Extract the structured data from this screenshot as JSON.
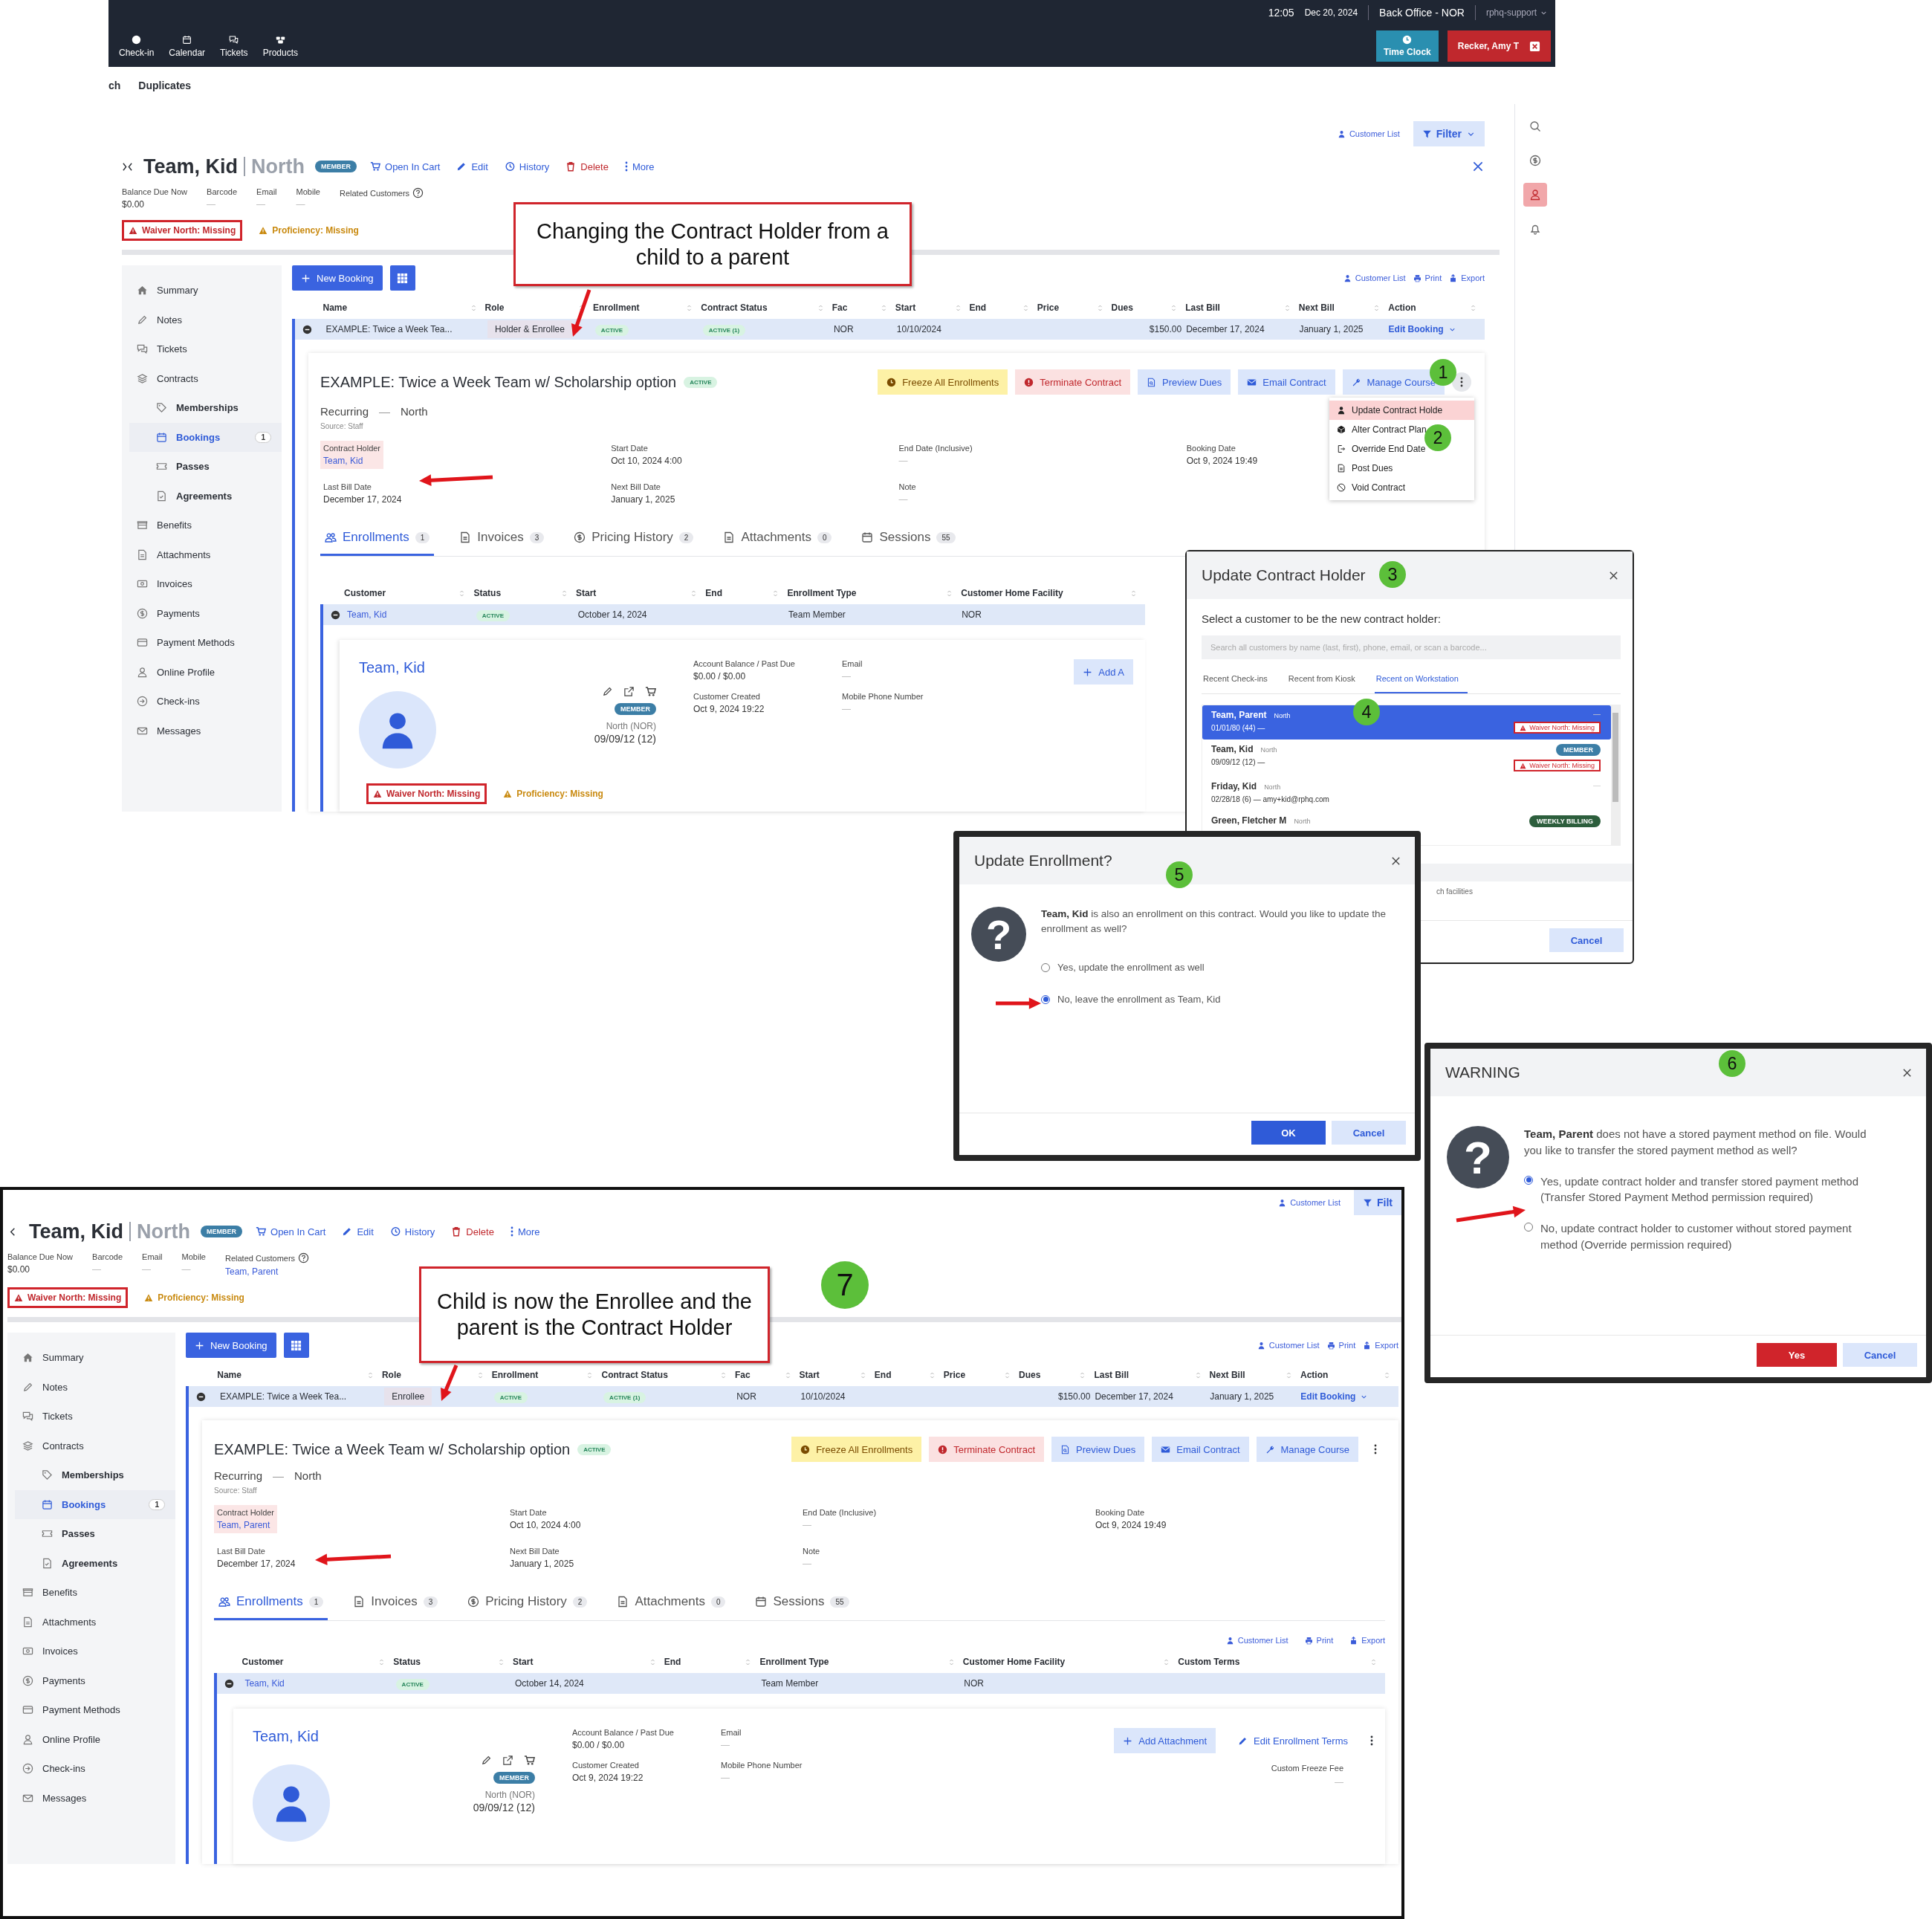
{
  "top_bar": {
    "time": "12:05",
    "date": "Dec 20, 2024",
    "location": "Back Office - NOR",
    "user_menu": "rphq-support",
    "nav": [
      {
        "label": "Check-in",
        "kind": "checkin"
      },
      {
        "label": "Calendar",
        "kind": "calendar"
      },
      {
        "label": "Tickets",
        "kind": "tickets"
      },
      {
        "label": "Products",
        "kind": "products"
      }
    ],
    "time_clock": "Time Clock",
    "staff": "Recker, Amy T"
  },
  "subnav": [
    {
      "label": "ch"
    },
    {
      "label": "Duplicates"
    }
  ],
  "rail": [
    {
      "kind": "search",
      "selected": false
    },
    {
      "kind": "dollar",
      "selected": false
    },
    {
      "kind": "profile",
      "selected": true
    },
    {
      "kind": "bell",
      "selected": false
    }
  ],
  "panels": [
    {
      "tools": [
        {
          "label": "Customer List",
          "kind": "link"
        },
        {
          "label": "Filter",
          "kind": "filter"
        }
      ],
      "name": "Team, Kid",
      "facility": "North",
      "badge": "MEMBER",
      "actions": [
        {
          "label": "Open In Cart",
          "kind": "cart"
        },
        {
          "label": "Edit",
          "kind": "edit"
        },
        {
          "label": "History",
          "kind": "history"
        },
        {
          "label": "Delete",
          "kind": "delete"
        },
        {
          "label": "More",
          "kind": "more"
        }
      ],
      "info": [
        {
          "label": "Balance Due Now",
          "value": "$0.00"
        },
        {
          "label": "Barcode",
          "value": "—"
        },
        {
          "label": "Email",
          "value": "—"
        },
        {
          "label": "Mobile",
          "value": "—"
        },
        {
          "label": "Related Customers",
          "help": true
        }
      ],
      "alerts": [
        {
          "label": "Waiver North: Missing",
          "kind": "error"
        },
        {
          "label": "Proficiency: Missing",
          "kind": "warning"
        }
      ],
      "sidebar": [
        {
          "label": "Summary",
          "kind": "home",
          "selected": false
        },
        {
          "label": "Notes",
          "kind": "notes",
          "selected": false
        },
        {
          "label": "Tickets",
          "kind": "tickets",
          "selected": false
        },
        {
          "label": "Contracts",
          "kind": "contracts",
          "selected": false,
          "children": [
            {
              "label": "Memberships",
              "kind": "tag",
              "selected": false
            },
            {
              "label": "Bookings",
              "kind": "calendar",
              "selected": true,
              "count": "1"
            },
            {
              "label": "Passes",
              "kind": "pass",
              "selected": false
            },
            {
              "label": "Agreements",
              "kind": "agreement",
              "selected": false
            }
          ]
        },
        {
          "label": "Benefits",
          "kind": "benefits",
          "selected": false
        },
        {
          "label": "Attachments",
          "kind": "file",
          "selected": false
        },
        {
          "label": "Invoices",
          "kind": "invoice",
          "selected": false
        },
        {
          "label": "Payments",
          "kind": "dollar",
          "selected": false
        },
        {
          "label": "Payment Methods",
          "kind": "card",
          "selected": false
        },
        {
          "label": "Online Profile",
          "kind": "profile",
          "selected": false
        },
        {
          "label": "Check-ins",
          "kind": "checkin",
          "selected": false
        },
        {
          "label": "Messages",
          "kind": "messages",
          "selected": false
        }
      ],
      "new_booking": "New Booking",
      "table_tools": [
        {
          "label": "Customer List",
          "kind": "person"
        },
        {
          "label": "Print",
          "kind": "print"
        },
        {
          "label": "Export",
          "kind": "export"
        }
      ],
      "bookings": {
        "columns": [
          "Name",
          "Role",
          "Enrollment",
          "Contract Status",
          "Fac",
          "Start",
          "End",
          "Price",
          "Dues",
          "Last Bill",
          "Next Bill",
          "Action"
        ],
        "rows": [
          {
            "expanded": true,
            "name": "EXAMPLE: Twice a Week Tea...",
            "role": "Holder & Enrollee",
            "enrollment": "ACTIVE",
            "contract_status": "ACTIVE (1)",
            "fac": "NOR",
            "start": "10/10/2024",
            "dues": "$150.00",
            "last_bill": "December 17, 2024",
            "next_bill": "January 1, 2025",
            "action": "Edit Booking"
          }
        ]
      },
      "contract": {
        "title": "EXAMPLE: Twice a Week Team w/ Scholarship option",
        "status": "ACTIVE",
        "buttons": [
          {
            "label": "Freeze All Enrollments",
            "kind": "freeze"
          },
          {
            "label": "Terminate Contract",
            "kind": "terminate"
          },
          {
            "label": "Preview Dues",
            "kind": "preview"
          },
          {
            "label": "Email Contract",
            "kind": "email"
          },
          {
            "label": "Manage Course",
            "kind": "manage"
          }
        ],
        "menu": {
          "expanded": true,
          "items": [
            {
              "label": "Update Contract Holde",
              "kind": "person",
              "selected": true
            },
            {
              "label": "Alter Contract Plan",
              "kind": "cube",
              "selected": false
            },
            {
              "label": "Override End Date",
              "kind": "exit",
              "selected": false
            },
            {
              "label": "Post Dues",
              "kind": "file",
              "selected": false
            },
            {
              "label": "Void Contract",
              "kind": "ban",
              "selected": false
            }
          ]
        },
        "type": "Recurring",
        "separator": "—",
        "facility": "North",
        "source": "Source: Staff",
        "fields": [
          {
            "label": "Contract Holder",
            "value": "Team, Kid",
            "kind": "link",
            "highlighted": true
          },
          {
            "label": "Start Date",
            "value": "Oct 10, 2024 4:00",
            "kind": "text",
            "highlighted": false
          },
          {
            "label": "End Date (Inclusive)",
            "value": "—",
            "kind": "text",
            "highlighted": false
          },
          {
            "label": "Booking Date",
            "value": "Oct 9, 2024 19:49",
            "kind": "text",
            "highlighted": false
          },
          {
            "label": "Last Bill Date",
            "value": "December 17, 2024",
            "kind": "text",
            "highlighted": false
          },
          {
            "label": "Next Bill Date",
            "value": "January 1, 2025",
            "kind": "text",
            "highlighted": false
          },
          {
            "label": "Note",
            "value": "—",
            "kind": "text",
            "highlighted": false
          }
        ]
      },
      "tabs": [
        {
          "label": "Enrollments",
          "count": "1",
          "kind": "people",
          "selected": true
        },
        {
          "label": "Invoices",
          "count": "3",
          "kind": "file",
          "selected": false
        },
        {
          "label": "Pricing History",
          "count": "2",
          "kind": "dollar",
          "selected": false
        },
        {
          "label": "Attachments",
          "count": "0",
          "kind": "file",
          "selected": false
        },
        {
          "label": "Sessions",
          "count": "55",
          "kind": "calendar",
          "selected": false
        }
      ],
      "enrollments": {
        "columns": [
          "Customer",
          "Status",
          "Start",
          "End",
          "Enrollment Type",
          "Customer Home Facility"
        ],
        "rows": [
          {
            "expanded": true,
            "customer": "Team, Kid",
            "status": "ACTIVE",
            "start": "October 14, 2024",
            "enrollment_type": "Team Member",
            "home_facility": "NOR"
          }
        ]
      },
      "enrollee": {
        "name": "Team, Kid",
        "badge": "MEMBER",
        "facility": "North (NOR)",
        "dob": "09/09/12 (12)",
        "fields": [
          {
            "label": "Account Balance / Past Due",
            "value": "$0.00 / $0.00"
          },
          {
            "label": "Email",
            "value": "—"
          },
          {
            "label": "Customer Created",
            "value": "Oct 9, 2024 19:22"
          },
          {
            "label": "Mobile Phone Number",
            "value": "—"
          }
        ],
        "buttons": [
          {
            "label": "Add A",
            "kind": "add"
          }
        ],
        "alerts": [
          {
            "label": "Waiver North: Missing",
            "kind": "error"
          },
          {
            "label": "Proficiency: Missing",
            "kind": "warning"
          }
        ]
      }
    },
    {
      "tools": [
        {
          "label": "Customer List",
          "kind": "link"
        },
        {
          "label": "Filt",
          "kind": "filter"
        }
      ],
      "name": "Team, Kid",
      "facility": "North",
      "badge": "MEMBER",
      "actions": [
        {
          "label": "Open In Cart",
          "kind": "cart"
        },
        {
          "label": "Edit",
          "kind": "edit"
        },
        {
          "label": "History",
          "kind": "history"
        },
        {
          "label": "Delete",
          "kind": "delete"
        },
        {
          "label": "More",
          "kind": "more"
        }
      ],
      "info": [
        {
          "label": "Balance Due Now",
          "value": "$0.00"
        },
        {
          "label": "Barcode",
          "value": "—"
        },
        {
          "label": "Email",
          "value": "—"
        },
        {
          "label": "Mobile",
          "value": "—"
        },
        {
          "label": "Related Customers",
          "help": true,
          "value": "Team, Parent",
          "link": true
        }
      ],
      "alerts": [
        {
          "label": "Waiver North: Missing",
          "kind": "error"
        },
        {
          "label": "Proficiency: Missing",
          "kind": "warning"
        }
      ],
      "sidebar": [
        {
          "label": "Summary",
          "kind": "home",
          "selected": false
        },
        {
          "label": "Notes",
          "kind": "notes",
          "selected": false
        },
        {
          "label": "Tickets",
          "kind": "tickets",
          "selected": false
        },
        {
          "label": "Contracts",
          "kind": "contracts",
          "selected": false,
          "children": [
            {
              "label": "Memberships",
              "kind": "tag",
              "selected": false
            },
            {
              "label": "Bookings",
              "kind": "calendar",
              "selected": true,
              "count": "1"
            },
            {
              "label": "Passes",
              "kind": "pass",
              "selected": false
            },
            {
              "label": "Agreements",
              "kind": "agreement",
              "selected": false
            }
          ]
        },
        {
          "label": "Benefits",
          "kind": "benefits",
          "selected": false
        },
        {
          "label": "Attachments",
          "kind": "file",
          "selected": false
        },
        {
          "label": "Invoices",
          "kind": "invoice",
          "selected": false
        },
        {
          "label": "Payments",
          "kind": "dollar",
          "selected": false
        },
        {
          "label": "Payment Methods",
          "kind": "card",
          "selected": false
        },
        {
          "label": "Online Profile",
          "kind": "profile",
          "selected": false
        },
        {
          "label": "Check-ins",
          "kind": "checkin",
          "selected": false
        },
        {
          "label": "Messages",
          "kind": "messages",
          "selected": false
        }
      ],
      "new_booking": "New Booking",
      "table_tools": [
        {
          "label": "Customer List",
          "kind": "person"
        },
        {
          "label": "Print",
          "kind": "print"
        },
        {
          "label": "Export",
          "kind": "export"
        }
      ],
      "bookings": {
        "columns": [
          "Name",
          "Role",
          "Enrollment",
          "Contract Status",
          "Fac",
          "Start",
          "End",
          "Price",
          "Dues",
          "Last Bill",
          "Next Bill",
          "Action"
        ],
        "rows": [
          {
            "expanded": true,
            "name": "EXAMPLE: Twice a Week Tea...",
            "role": "Enrollee",
            "enrollment": "ACTIVE",
            "contract_status": "ACTIVE (1)",
            "fac": "NOR",
            "start": "10/10/2024",
            "dues": "$150.00",
            "last_bill": "December 17, 2024",
            "next_bill": "January 1, 2025",
            "action": "Edit Booking"
          }
        ]
      },
      "contract": {
        "title": "EXAMPLE: Twice a Week Team w/ Scholarship option",
        "status": "ACTIVE",
        "buttons": [
          {
            "label": "Freeze All Enrollments",
            "kind": "freeze"
          },
          {
            "label": "Terminate Contract",
            "kind": "terminate"
          },
          {
            "label": "Preview Dues",
            "kind": "preview"
          },
          {
            "label": "Email Contract",
            "kind": "email"
          },
          {
            "label": "Manage Course",
            "kind": "manage"
          }
        ],
        "type": "Recurring",
        "separator": "—",
        "facility": "North",
        "source": "Source: Staff",
        "fields": [
          {
            "label": "Contract Holder",
            "value": "Team, Parent",
            "kind": "link",
            "highlighted": true
          },
          {
            "label": "Start Date",
            "value": "Oct 10, 2024 4:00",
            "kind": "text",
            "highlighted": false
          },
          {
            "label": "End Date (Inclusive)",
            "value": "—",
            "kind": "text",
            "highlighted": false
          },
          {
            "label": "Booking Date",
            "value": "Oct 9, 2024 19:49",
            "kind": "text",
            "highlighted": false
          },
          {
            "label": "Last Bill Date",
            "value": "December 17, 2024",
            "kind": "text",
            "highlighted": false
          },
          {
            "label": "Next Bill Date",
            "value": "January 1, 2025",
            "kind": "text",
            "highlighted": false
          },
          {
            "label": "Note",
            "value": "—",
            "kind": "text",
            "highlighted": false
          }
        ]
      },
      "tabs": [
        {
          "label": "Enrollments",
          "count": "1",
          "kind": "people",
          "selected": true
        },
        {
          "label": "Invoices",
          "count": "3",
          "kind": "file",
          "selected": false
        },
        {
          "label": "Pricing History",
          "count": "2",
          "kind": "dollar",
          "selected": false
        },
        {
          "label": "Attachments",
          "count": "0",
          "kind": "file",
          "selected": false
        },
        {
          "label": "Sessions",
          "count": "55",
          "kind": "calendar",
          "selected": false
        }
      ],
      "enrollment_tools": [
        {
          "label": "Customer List",
          "kind": "person"
        },
        {
          "label": "Print",
          "kind": "print"
        },
        {
          "label": "Export",
          "kind": "export"
        }
      ],
      "enrollments": {
        "columns": [
          "Customer",
          "Status",
          "Start",
          "End",
          "Enrollment Type",
          "Customer Home Facility",
          "Custom Terms"
        ],
        "rows": [
          {
            "expanded": true,
            "customer": "Team, Kid",
            "status": "ACTIVE",
            "start": "October 14, 2024",
            "enrollment_type": "Team Member",
            "home_facility": "NOR"
          }
        ]
      },
      "enrollee": {
        "name": "Team, Kid",
        "badge": "MEMBER",
        "facility": "North (NOR)",
        "dob": "09/09/12 (12)",
        "fields": [
          {
            "label": "Account Balance / Past Due",
            "value": "$0.00 / $0.00"
          },
          {
            "label": "Email",
            "value": "—"
          },
          {
            "label": "Customer Created",
            "value": "Oct 9, 2024 19:22"
          },
          {
            "label": "Mobile Phone Number",
            "value": "—"
          }
        ],
        "buttons": [
          {
            "label": "Add Attachment",
            "kind": "add"
          },
          {
            "label": "Edit Enrollment Terms",
            "kind": "edit"
          }
        ],
        "freeze_fee": {
          "label": "Custom Freeze Fee",
          "value": "—"
        }
      }
    }
  ],
  "modals": [
    {
      "kind": "holder",
      "title": "Update Contract Holder",
      "prompt": "Select a customer to be the new contract holder:",
      "search": {
        "placeholder": "Search all customers by name (last, first), phone, email, or scan a barcode..."
      },
      "tabs": [
        {
          "label": "Recent Check-ins",
          "selected": false
        },
        {
          "label": "Recent from Kiosk",
          "selected": false
        },
        {
          "label": "Recent on Workstation",
          "selected": true
        }
      ],
      "customers": [
        {
          "name": "Team, Parent",
          "facility": "North",
          "detail": "01/01/80 (44) —",
          "selected": true,
          "tags": [
            {
              "kind": "dash",
              "label": "—"
            },
            {
              "kind": "waiver",
              "label": "Waiver North: Missing"
            }
          ]
        },
        {
          "name": "Team, Kid",
          "facility": "North",
          "detail": "09/09/12 (12) —",
          "selected": false,
          "tags": [
            {
              "kind": "member",
              "label": "MEMBER"
            },
            {
              "kind": "waiver",
              "label": "Waiver North: Missing"
            }
          ]
        },
        {
          "name": "Friday, Kid",
          "facility": "North",
          "detail": "02/28/18 (6) — amy+kid@rphq.com",
          "selected": false,
          "tags": [
            {
              "kind": "dash",
              "label": "—"
            }
          ]
        },
        {
          "name": "Green, Fletcher M",
          "facility": "North",
          "selected": false,
          "tags": [
            {
              "kind": "billing",
              "label": "WEEKLY BILLING"
            }
          ]
        }
      ],
      "footnote": "ch facilities",
      "buttons": [
        {
          "label": "Cancel",
          "kind": "secondary"
        }
      ]
    },
    {
      "kind": "question",
      "title": "Update Enrollment?",
      "glyph": "?",
      "message": "**Team, Kid** is also an enrollment on this contract. Would you like to update the enrollment as well?",
      "options": [
        {
          "label": "Yes, update the enrollment as well",
          "selected": false
        },
        {
          "label": "No, leave the enrollment as Team, Kid",
          "selected": true
        }
      ],
      "buttons": [
        {
          "label": "OK",
          "kind": "primary"
        },
        {
          "label": "Cancel",
          "kind": "secondary"
        }
      ]
    },
    {
      "kind": "question",
      "title": "WARNING",
      "glyph": "?",
      "message": "**Team, Parent** does not have a stored payment method on file. Would you like to transfer the stored payment method as well?",
      "options": [
        {
          "label": "Yes, update contract holder and transfer stored payment method (Transfer Stored Payment Method permission required)",
          "selected": true
        },
        {
          "label": "No, update contract holder to customer without stored payment method (Override permission required)",
          "selected": false
        }
      ],
      "buttons": [
        {
          "label": "Yes",
          "kind": "danger"
        },
        {
          "label": "Cancel",
          "kind": "secondary"
        }
      ]
    }
  ],
  "callouts": [
    {
      "text": "Changing the Contract Holder from a child to a parent"
    },
    {
      "text": "Child is now the Enrollee and the parent is the Contract Holder"
    }
  ],
  "steps": [
    {
      "label": "1"
    },
    {
      "label": "2"
    },
    {
      "label": "3"
    },
    {
      "label": "4"
    },
    {
      "label": "5"
    },
    {
      "label": "6"
    },
    {
      "label": "7"
    }
  ]
}
